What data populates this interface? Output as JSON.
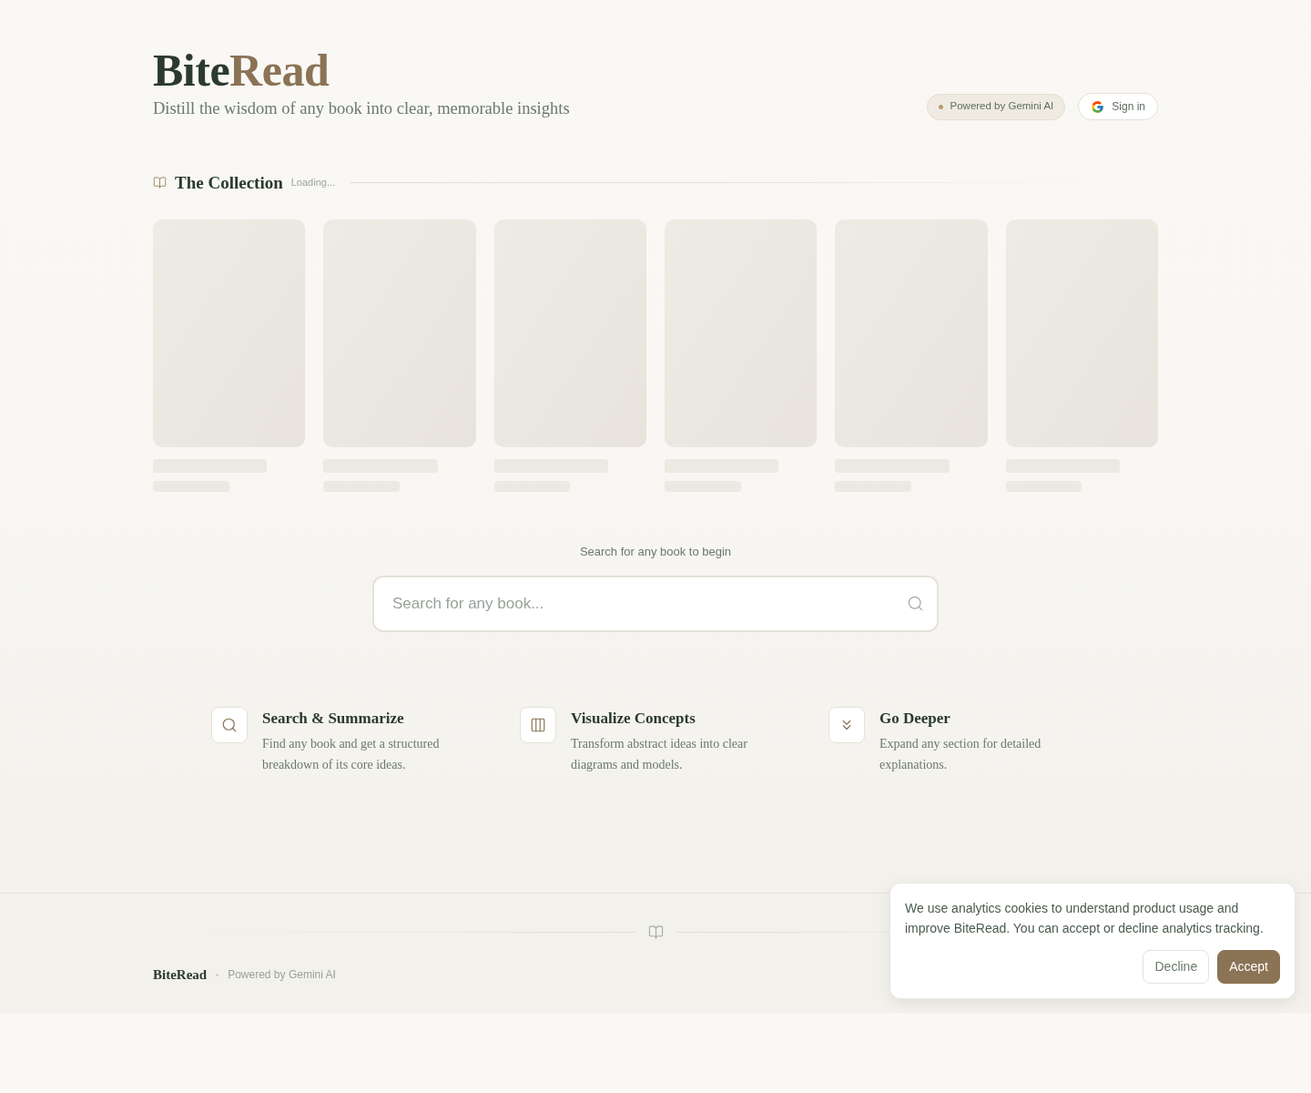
{
  "header": {
    "logo": [
      "Bite",
      "Read"
    ],
    "tagline": "Distill the wisdom of any book into clear, memorable insights",
    "badge": "Powered by Gemini AI",
    "sign_in": "Sign in"
  },
  "collection": {
    "title": "The Collection",
    "status": "Loading...",
    "books": [
      {
        "loading": true
      },
      {
        "loading": true
      },
      {
        "loading": true
      },
      {
        "loading": true
      },
      {
        "loading": true
      },
      {
        "loading": true
      }
    ]
  },
  "search": {
    "prompt": "Search for any book to begin",
    "placeholder": "Search for any book..."
  },
  "features": [
    {
      "kind": "search",
      "title": "Search & Summarize",
      "description": "Find any book and get a structured breakdown of its core ideas."
    },
    {
      "kind": "columns",
      "title": "Visualize Concepts",
      "description": "Transform abstract ideas into clear diagrams and models."
    },
    {
      "kind": "chevrons",
      "title": "Go Deeper",
      "description": "Expand any section for detailed explanations."
    }
  ],
  "footer": {
    "brand": "BiteRead",
    "credit": "Powered by Gemini AI"
  },
  "cookie_banner": {
    "message": "We use analytics cookies to understand product usage and improve BiteRead. You can accept or decline analytics tracking.",
    "buttons": [
      {
        "label": "Decline",
        "kind": "secondary"
      },
      {
        "label": "Accept",
        "kind": "primary"
      }
    ]
  }
}
